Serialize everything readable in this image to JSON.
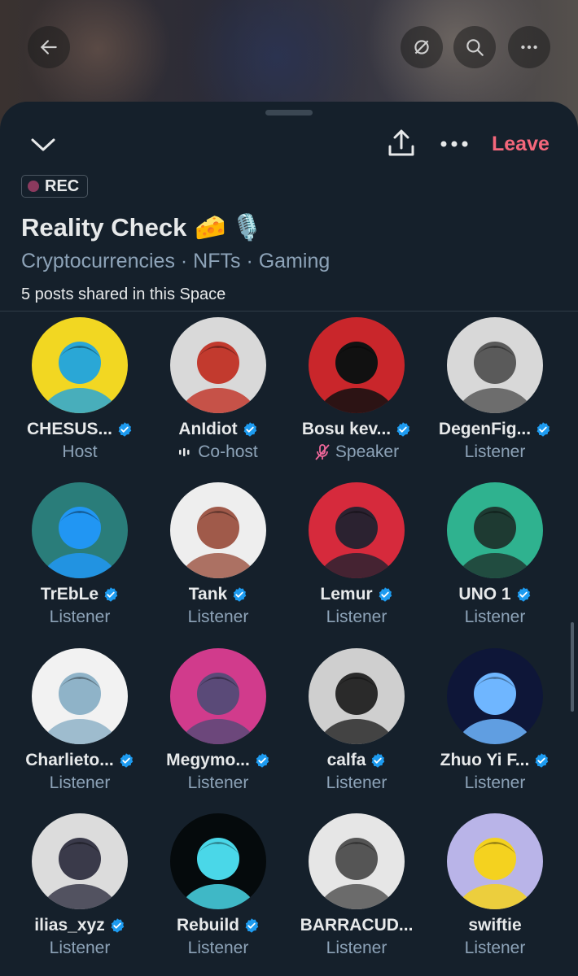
{
  "header": {
    "leave_label": "Leave",
    "rec_label": "REC",
    "title": "Reality Check",
    "title_emojis": [
      "🧀",
      "🎙️"
    ],
    "tags": "Cryptocurrencies · NFTs · Gaming",
    "posts_shared": "5 posts shared in this Space"
  },
  "colors": {
    "background": "#15202b",
    "leave": "#f4677b",
    "verified": "#1d9bf0",
    "muted_text": "#8da3b8",
    "speaker_muted_icon": "#f0679a"
  },
  "participants": [
    {
      "name": "CHESUS...",
      "role": "Host",
      "verified": true,
      "role_icon": "",
      "avatar_bg": "#f2d722",
      "avatar_fg": "#2aa7d6"
    },
    {
      "name": "AnIdiot",
      "role": "Co-host",
      "verified": true,
      "role_icon": "audio-bars-icon",
      "avatar_bg": "#d9d9d9",
      "avatar_fg": "#c23a2e"
    },
    {
      "name": "Bosu kev...",
      "role": "Speaker",
      "verified": true,
      "role_icon": "mic-muted-icon",
      "avatar_bg": "#c9262b",
      "avatar_fg": "#111111"
    },
    {
      "name": "DegenFig...",
      "role": "Listener",
      "verified": true,
      "role_icon": "",
      "avatar_bg": "#d8d8d8",
      "avatar_fg": "#5a5a5a"
    },
    {
      "name": "TrEbLe",
      "role": "Listener",
      "verified": true,
      "role_icon": "",
      "avatar_bg": "#2a7d7a",
      "avatar_fg": "#2196f3"
    },
    {
      "name": "Tank",
      "role": "Listener",
      "verified": true,
      "role_icon": "",
      "avatar_bg": "#eeeeee",
      "avatar_fg": "#a05a4a"
    },
    {
      "name": "Lemur",
      "role": "Listener",
      "verified": true,
      "role_icon": "",
      "avatar_bg": "#d62a3c",
      "avatar_fg": "#2b2230"
    },
    {
      "name": "UNO 1",
      "role": "Listener",
      "verified": true,
      "role_icon": "",
      "avatar_bg": "#2fb28f",
      "avatar_fg": "#1e3a32"
    },
    {
      "name": "Charlieto...",
      "role": "Listener",
      "verified": true,
      "role_icon": "",
      "avatar_bg": "#f2f2f2",
      "avatar_fg": "#8fb3c8"
    },
    {
      "name": "Megymo...",
      "role": "Listener",
      "verified": true,
      "role_icon": "",
      "avatar_bg": "#d13b8c",
      "avatar_fg": "#5a4a78"
    },
    {
      "name": "calfa",
      "role": "Listener",
      "verified": true,
      "role_icon": "",
      "avatar_bg": "#cfcfcf",
      "avatar_fg": "#2a2a2a"
    },
    {
      "name": "Zhuo Yi F...",
      "role": "Listener",
      "verified": true,
      "role_icon": "",
      "avatar_bg": "#0e1638",
      "avatar_fg": "#6fb6ff"
    },
    {
      "name": "ilias_xyz",
      "role": "Listener",
      "verified": true,
      "role_icon": "",
      "avatar_bg": "#dcdcdc",
      "avatar_fg": "#3a3a4a"
    },
    {
      "name": "Rebuild",
      "role": "Listener",
      "verified": true,
      "role_icon": "",
      "avatar_bg": "#050a0c",
      "avatar_fg": "#4ad7e8"
    },
    {
      "name": "BARRACUD...",
      "role": "Listener",
      "verified": false,
      "role_icon": "",
      "avatar_bg": "#e6e6e6",
      "avatar_fg": "#555555"
    },
    {
      "name": "swiftie",
      "role": "Listener",
      "verified": false,
      "role_icon": "",
      "avatar_bg": "#b9b4e8",
      "avatar_fg": "#f4d21f"
    }
  ]
}
